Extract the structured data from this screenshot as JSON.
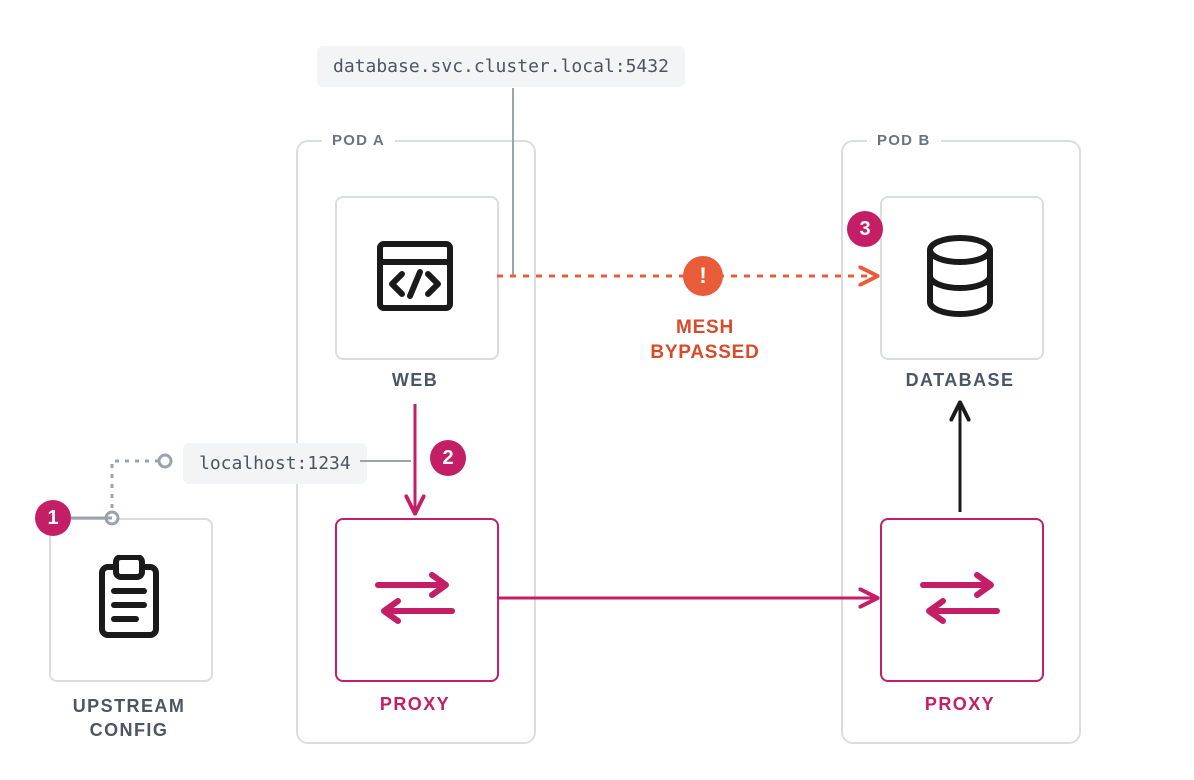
{
  "callouts": {
    "db_addr": "database.svc.cluster.local:5432",
    "local_addr": "localhost:1234"
  },
  "pods": {
    "a": {
      "title": "POD A"
    },
    "b": {
      "title": "POD B"
    }
  },
  "labels": {
    "web": "WEB",
    "proxy_a": "PROXY",
    "proxy_b": "PROXY",
    "database": "DATABASE",
    "upstream_line1": "UPSTREAM",
    "upstream_line2": "CONFIG",
    "mesh_line1": "MESH",
    "mesh_line2": "BYPASSED"
  },
  "badges": {
    "one": "1",
    "two": "2",
    "three": "3",
    "alert": "!"
  },
  "colors": {
    "pink": "#c41e67",
    "orange": "#e85c3a",
    "grey_line": "#dadde0",
    "grey_text": "#4b5563",
    "black": "#1a1a1a"
  }
}
